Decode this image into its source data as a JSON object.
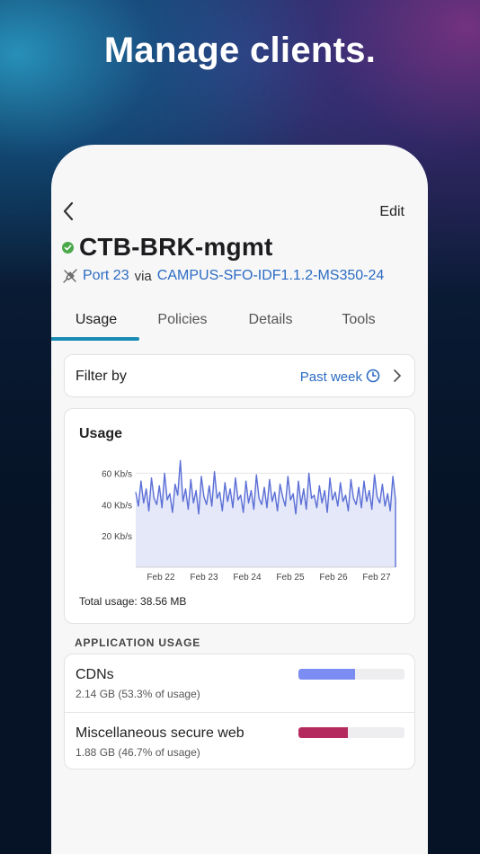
{
  "headline": "Manage clients.",
  "topbar": {
    "edit_label": "Edit"
  },
  "client": {
    "name": "CTB-BRK-mgmt",
    "status_color": "#4aa84a",
    "port_label": "Port 23",
    "via_label": "via",
    "switch_label": "CAMPUS-SFO-IDF1.1.2-MS350-24"
  },
  "tabs": [
    {
      "label": "Usage",
      "active": true
    },
    {
      "label": "Policies",
      "active": false
    },
    {
      "label": "Details",
      "active": false
    },
    {
      "label": "Tools",
      "active": false
    }
  ],
  "filter": {
    "label": "Filter by",
    "value": "Past week"
  },
  "usage": {
    "title": "Usage",
    "total_label": "Total usage: 38.56 MB"
  },
  "chart_data": {
    "type": "area",
    "title": "Usage",
    "y_ticks": [
      "60 Kb/s",
      "40 Kb/s",
      "20 Kb/s"
    ],
    "y_tick_values": [
      60,
      40,
      20
    ],
    "ylim": [
      0,
      70
    ],
    "x_ticks": [
      "Feb 22",
      "Feb 23",
      "Feb 24",
      "Feb 25",
      "Feb 26",
      "Feb 27"
    ],
    "series": [
      {
        "color": "#5b6fd6",
        "fill": "#e4e8f8",
        "values": [
          48,
          39,
          55,
          41,
          50,
          36,
          57,
          44,
          40,
          52,
          38,
          60,
          43,
          47,
          35,
          53,
          46,
          68,
          42,
          50,
          37,
          56,
          41,
          49,
          34,
          58,
          45,
          40,
          52,
          39,
          61,
          44,
          48,
          36,
          54,
          42,
          50,
          38,
          57,
          43,
          46,
          35,
          55,
          41,
          49,
          37,
          59,
          44,
          40,
          51,
          38,
          56,
          42,
          48,
          36,
          53,
          45,
          39,
          58,
          43,
          47,
          34,
          55,
          40,
          50,
          37,
          60,
          44,
          46,
          38,
          52,
          41,
          49,
          35,
          57,
          43,
          48,
          39,
          54,
          42,
          46,
          36,
          56,
          44,
          40,
          51,
          38,
          55,
          42,
          49,
          37,
          59,
          45,
          41,
          53,
          39,
          47,
          36,
          58,
          43
        ]
      }
    ]
  },
  "app_usage": {
    "header": "APPLICATION USAGE",
    "items": [
      {
        "name": "CDNs",
        "detail": "2.14 GB (53.3% of usage)",
        "share": 0.533,
        "color": "#7b8cf2"
      },
      {
        "name": "Miscellaneous secure web",
        "detail": "1.88 GB (46.7% of usage)",
        "share": 0.467,
        "color": "#b52a5e"
      }
    ]
  }
}
